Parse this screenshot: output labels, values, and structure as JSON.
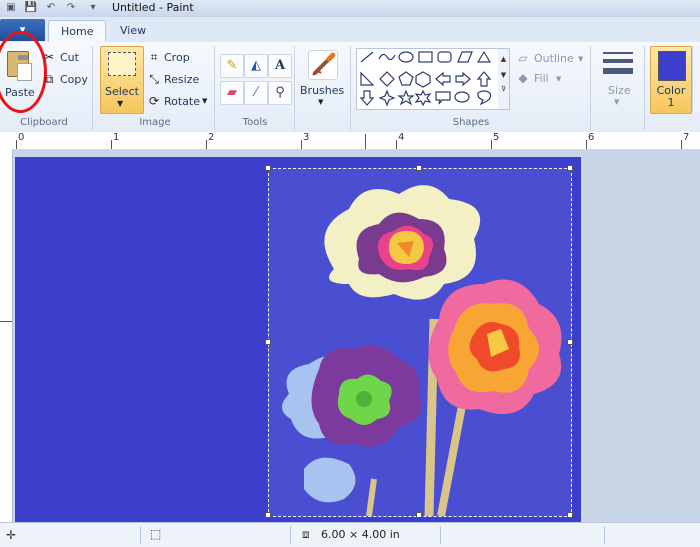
{
  "window": {
    "title": "Untitled - Paint"
  },
  "tabs": {
    "file": "▾",
    "home": "Home",
    "view": "View"
  },
  "clipboard": {
    "group": "Clipboard",
    "paste": "Paste",
    "cut": "Cut",
    "copy": "Copy"
  },
  "image": {
    "group": "Image",
    "select": "Select",
    "crop": "Crop",
    "resize": "Resize",
    "rotate": "Rotate"
  },
  "tools": {
    "group": "Tools"
  },
  "brushes": {
    "label": "Brushes"
  },
  "shapes": {
    "group": "Shapes",
    "outline": "Outline",
    "fill": "Fill"
  },
  "size": {
    "label": "Size"
  },
  "colors": {
    "color1_line1": "Color",
    "color1_line2": "1",
    "color1_hex": "#3c3fcb",
    "canvas_hex": "#3c3fcb"
  },
  "ruler": {
    "ticks": [
      "0",
      "1",
      "2",
      "3",
      "4",
      "5",
      "6",
      "7"
    ]
  },
  "status": {
    "image_size": "6.00 × 4.00 in"
  },
  "icons": {
    "paste": "clipboard-icon",
    "cut": "scissors-icon",
    "copy": "copy-icon",
    "crop": "crop-icon",
    "resize": "resize-icon",
    "rotate": "rotate-icon",
    "pencil": "pencil-icon",
    "fill": "fill-bucket-icon",
    "text": "text-icon",
    "eraser": "eraser-icon",
    "picker": "color-picker-icon",
    "magnifier": "magnifier-icon"
  }
}
